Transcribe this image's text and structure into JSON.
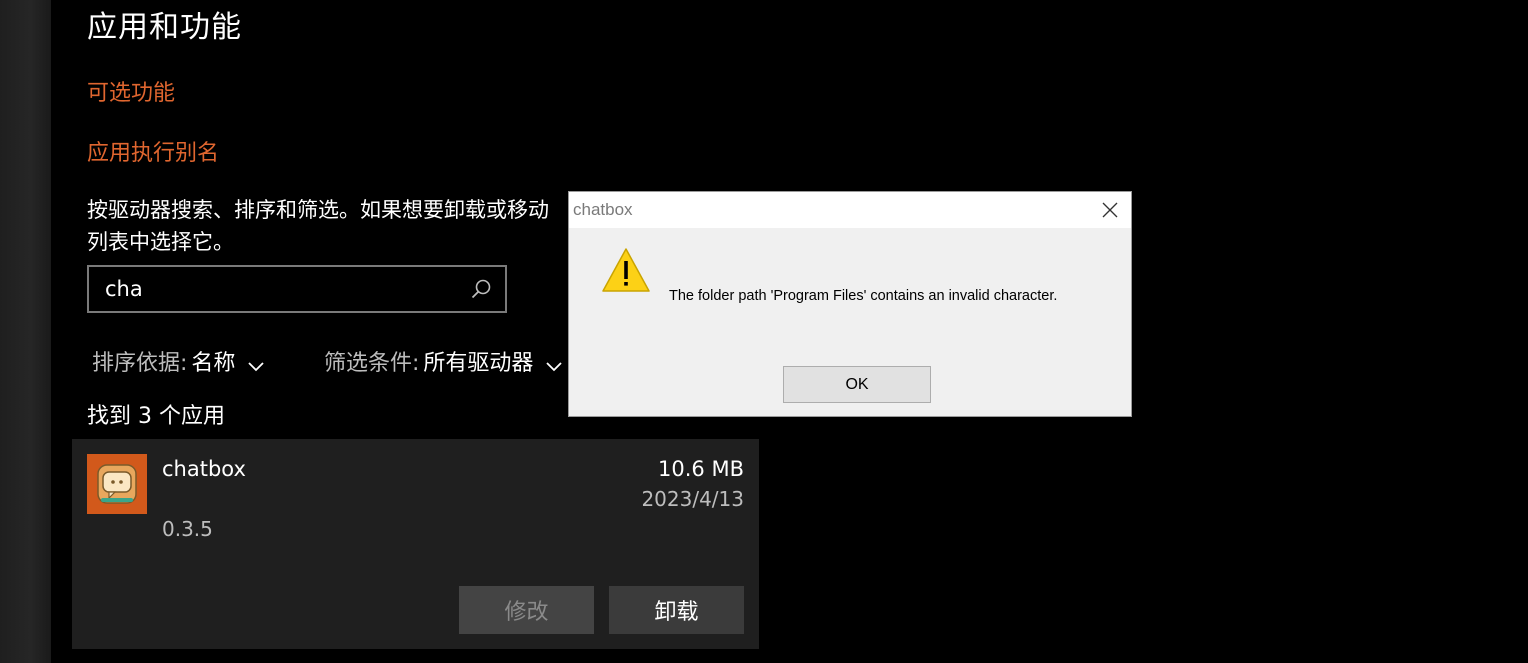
{
  "page": {
    "title": "应用和功能",
    "links": {
      "optional_features": "可选功能",
      "app_execution_aliases": "应用执行别名"
    },
    "description_line1": "按驱动器搜索、排序和筛选。如果想要卸载或移动",
    "description_line2": "列表中选择它。"
  },
  "search": {
    "value": "cha",
    "icon": "search-icon"
  },
  "sort": {
    "label": "排序依据:",
    "value": "名称"
  },
  "filter": {
    "label": "筛选条件:",
    "value": "所有驱动器"
  },
  "results": {
    "count_text": "找到 3 个应用"
  },
  "app": {
    "name": "chatbox",
    "version": "0.3.5",
    "size": "10.6 MB",
    "date": "2023/4/13",
    "modify_label": "修改",
    "uninstall_label": "卸载",
    "icon_color": "#d2591b"
  },
  "dialog": {
    "title": "chatbox",
    "message": "The folder path 'Program Files' contains an invalid character.",
    "ok_label": "OK",
    "icon": "warning-icon"
  },
  "colors": {
    "accent_link": "#e0662f",
    "background": "#000000",
    "card": "#1f1f1f"
  }
}
